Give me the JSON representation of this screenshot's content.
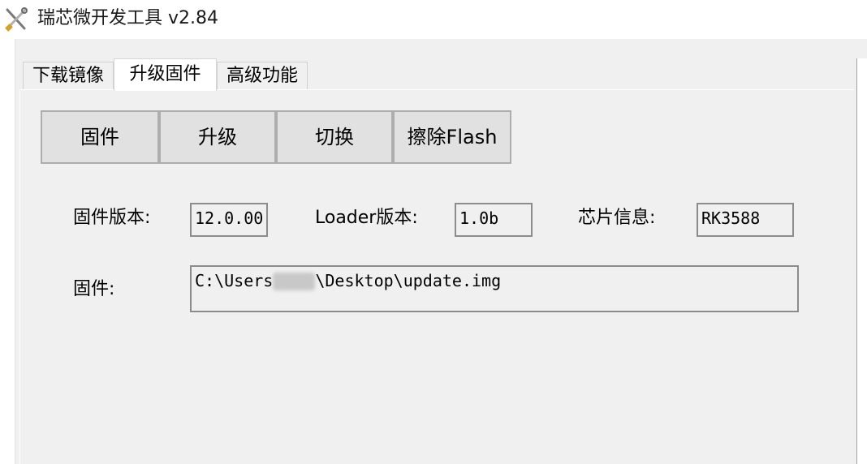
{
  "window": {
    "title": "瑞芯微开发工具 v2.84",
    "icon": "tools-icon"
  },
  "tabs": [
    {
      "label": "下载镜像",
      "active": false
    },
    {
      "label": "升级固件",
      "active": true
    },
    {
      "label": "高级功能",
      "active": false
    }
  ],
  "toolbar": {
    "firmware_label": "固件",
    "upgrade_label": "升级",
    "switch_label": "切换",
    "erase_label": "擦除Flash"
  },
  "info": {
    "firmware_version_label": "固件版本:",
    "firmware_version_value": "12.0.00",
    "loader_version_label": "Loader版本:",
    "loader_version_value": "1.0b",
    "chip_info_label": "芯片信息:",
    "chip_info_value": "RK3588"
  },
  "firmware_path": {
    "label": "固件:",
    "prefix": "C:\\Users",
    "suffix": "\\Desktop\\update.img"
  },
  "colors": {
    "panel_bg": "#f0f0f0",
    "button_bg": "#e1e1e1",
    "button_border": "#adadad",
    "field_border": "#8c8c8c"
  }
}
